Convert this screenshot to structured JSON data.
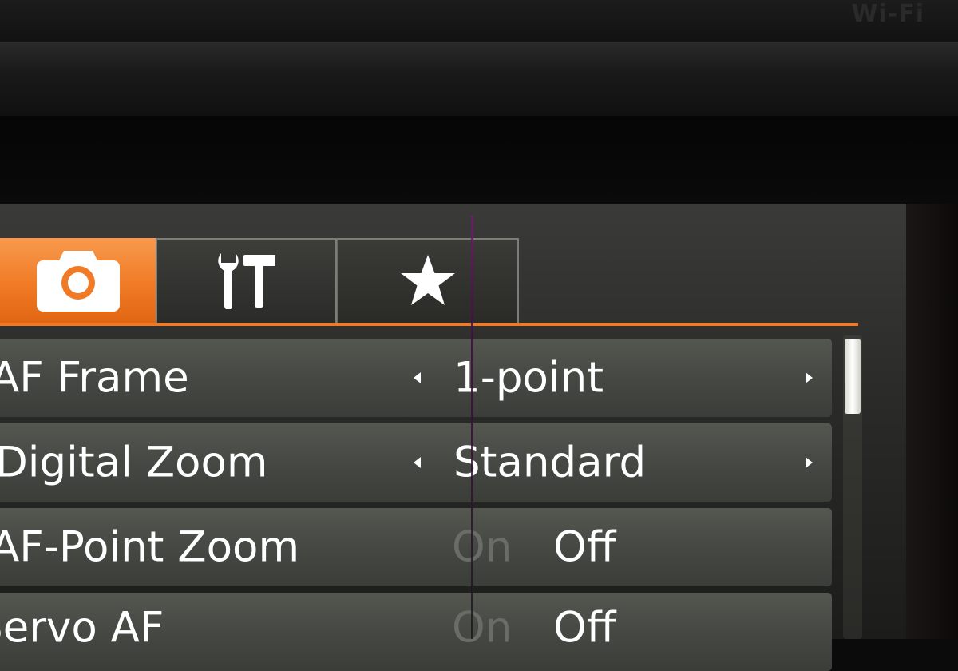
{
  "device": {
    "bezel_text": "Wi-Fi"
  },
  "tabs": [
    {
      "name": "shooting",
      "icon": "camera-icon",
      "active": true
    },
    {
      "name": "setup",
      "icon": "wrench-hammer-icon",
      "active": false
    },
    {
      "name": "my-menu",
      "icon": "star-icon",
      "active": false
    }
  ],
  "colors": {
    "accent": "#f07a25",
    "row_bg": "#464843",
    "text": "#ffffff",
    "dim_text": "#6a6c67"
  },
  "menu": {
    "items": [
      {
        "label": "AF Frame",
        "value": "1-point",
        "type": "selector"
      },
      {
        "label": "Digital Zoom",
        "value": "Standard",
        "type": "selector"
      },
      {
        "label": "AF-Point Zoom",
        "option_a": "On",
        "option_b": "Off",
        "selected": "Off",
        "type": "toggle"
      },
      {
        "label": "Servo AF",
        "option_a": "On",
        "option_b": "Off",
        "selected": "Off",
        "type": "toggle"
      }
    ]
  }
}
